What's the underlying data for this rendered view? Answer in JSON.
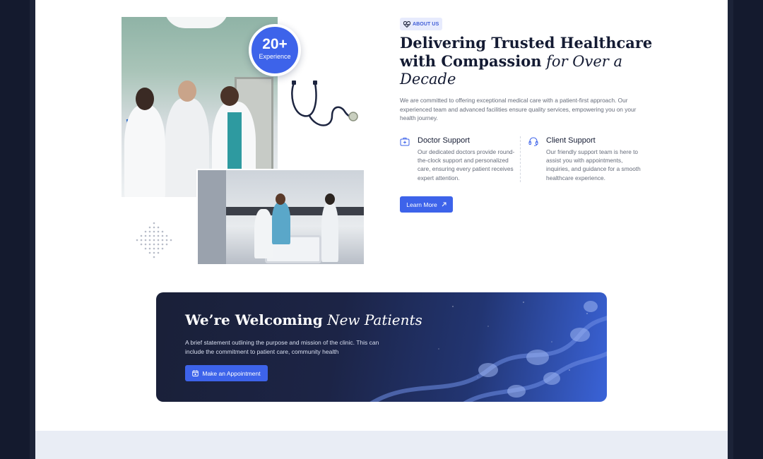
{
  "hero_badge": {
    "number": "20+",
    "label": "Experience"
  },
  "about": {
    "tag": "ABOUT US",
    "heading_bold": "Delivering Trusted Healthcare with Compassion",
    "heading_italic": "for Over a Decade",
    "paragraph": "We are committed to offering exceptional medical care with a patient-first approach. Our experienced team and advanced facilities ensure quality services, empowering you on your health journey.",
    "features": [
      {
        "icon": "medical-bag-icon",
        "title": "Doctor Support",
        "description": "Our dedicated doctors provide round-the-clock support and personalized care, ensuring every patient receives expert attention."
      },
      {
        "icon": "headset-icon",
        "title": "Client Support",
        "description": "Our friendly support team is here to assist you with appointments, inquiries, and guidance for a smooth healthcare experience."
      }
    ],
    "cta_label": "Learn More",
    "cta_icon": "arrow-up-right-icon"
  },
  "banner": {
    "title_bold": "We’re Welcoming",
    "title_italic": "New Patients",
    "text": "A brief statement outlining the purpose and mission of the clinic. This can include the commitment to patient care, community health",
    "cta_label": "Make an Appointment",
    "cta_icon": "calendar-icon"
  },
  "colors": {
    "accent": "#3d63ea",
    "heading": "#141b33",
    "body_text": "#666c7a",
    "banner_dark": "#1a2038",
    "page_bg": "#141a2e"
  }
}
